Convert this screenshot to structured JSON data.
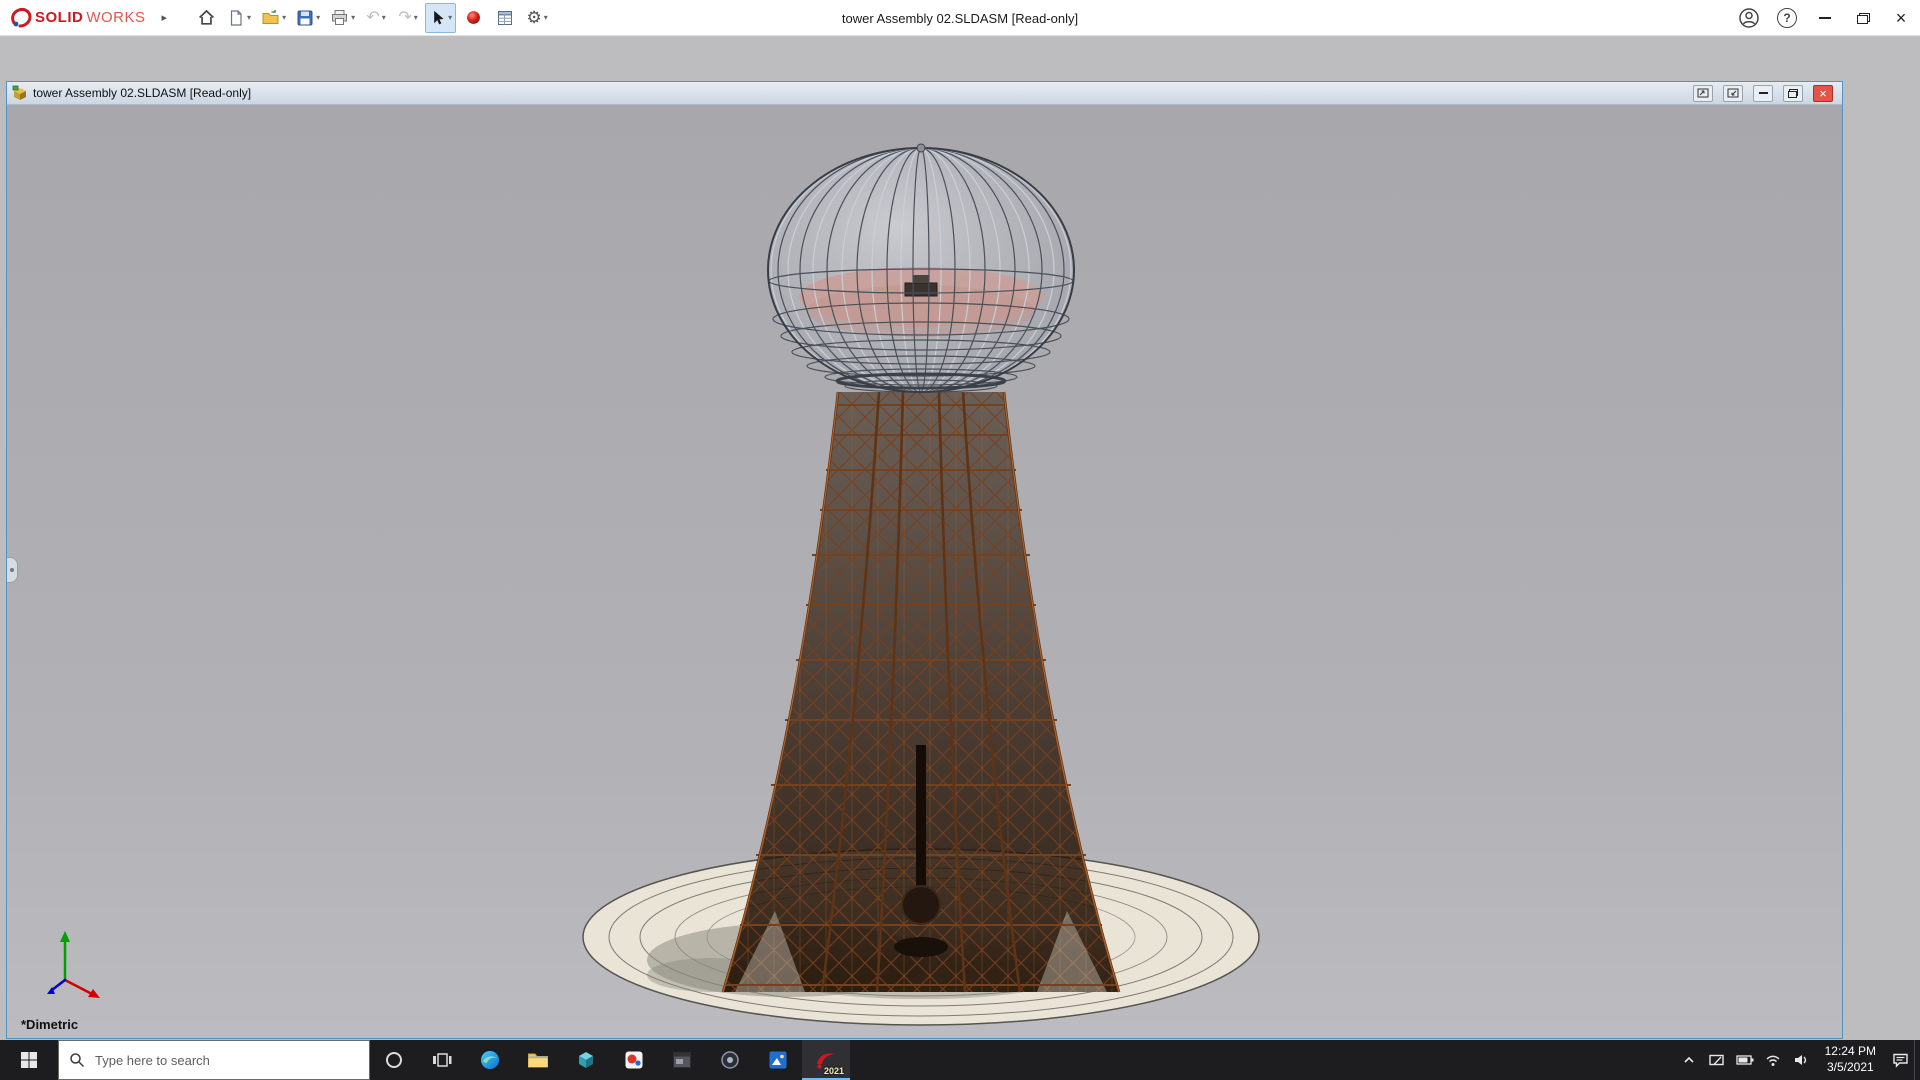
{
  "app": {
    "brand": {
      "solid": "SOLID",
      "works": "WORKS"
    },
    "title": "tower Assembly 02.SLDASM [Read-only]"
  },
  "doc_window": {
    "title": "tower Assembly 02.SLDASM [Read-only]"
  },
  "viewport": {
    "view_label": "*Dimetric"
  },
  "taskbar": {
    "search_placeholder": "Type here to search",
    "solidworks_badge": "2021",
    "clock": {
      "time": "12:24 PM",
      "date": "3/5/2021"
    }
  },
  "icons": {
    "flyout_arrow": "▸",
    "dropdown_caret": "▾",
    "undo": "↶",
    "redo": "↷",
    "options_gear": "⚙",
    "help": "?",
    "close": "×"
  },
  "colors": {
    "brand_red": "#d1171f",
    "taskbar_bg": "#1d1d20",
    "active_underline": "#76b9ed",
    "doc_border": "#4f94c4",
    "viewport_bg": "#aeaeb2",
    "tower_rust": "#7a3f1c",
    "platform_cream": "#e9e4d6"
  }
}
